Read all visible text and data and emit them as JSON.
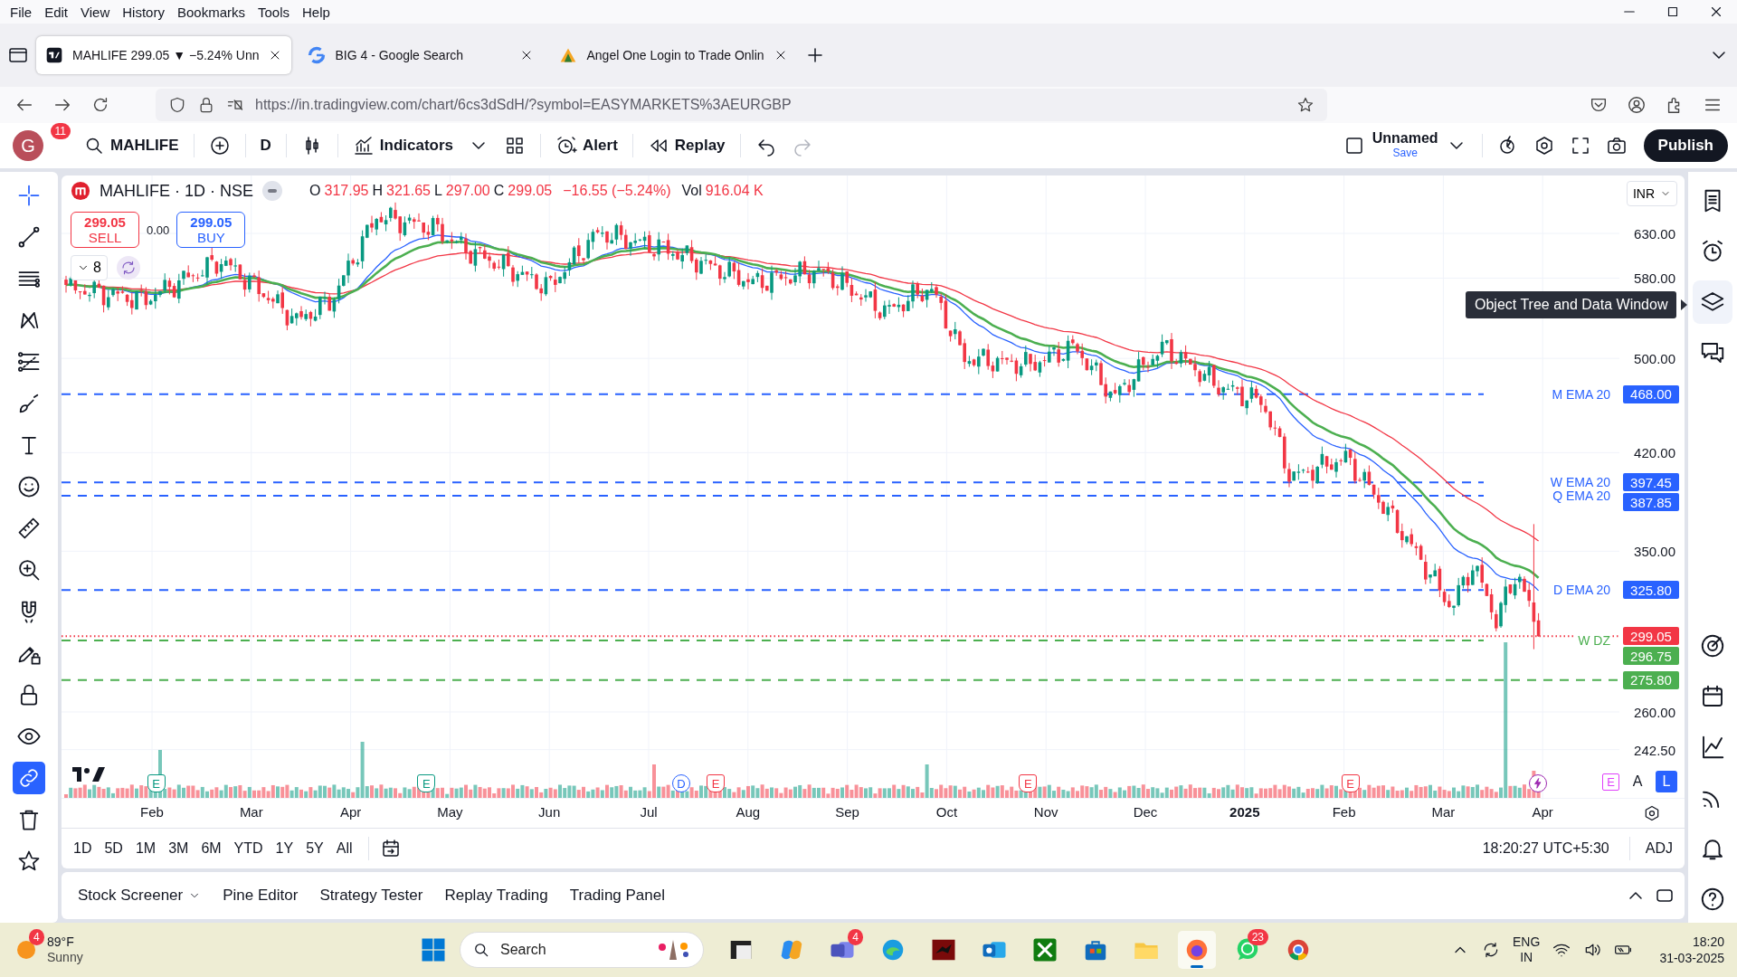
{
  "browser": {
    "menu": [
      "File",
      "Edit",
      "View",
      "History",
      "Bookmarks",
      "Tools",
      "Help"
    ],
    "tabs": [
      {
        "title": "MAHLIFE 299.05 ▼ −5.24% Unn",
        "kind": "tradingview",
        "selected": true
      },
      {
        "title": "BIG 4 - Google Search",
        "kind": "google",
        "selected": false
      },
      {
        "title": "Angel One Login to Trade Onlin",
        "kind": "angel",
        "selected": false
      }
    ],
    "url": "https://in.tradingview.com/chart/6cs3dSdH/?symbol=EASYMARKETS%3AEURGBP"
  },
  "toolbar": {
    "avatar": "G",
    "avatar_badge": "11",
    "symbol": "MAHLIFE",
    "interval": "D",
    "indicators": "Indicators",
    "alert": "Alert",
    "replay": "Replay",
    "layout_name": "Unnamed",
    "save": "Save",
    "publish": "Publish"
  },
  "left_tools": [
    {
      "kind": "crosshair",
      "selected": true,
      "on": false
    },
    {
      "kind": "trend-line",
      "selected": false,
      "on": false
    },
    {
      "kind": "lines",
      "selected": false,
      "on": false
    },
    {
      "kind": "pattern",
      "selected": false,
      "on": false
    },
    {
      "kind": "fib",
      "selected": false,
      "on": false
    },
    {
      "kind": "brush",
      "selected": false,
      "on": false
    },
    {
      "kind": "text",
      "selected": false,
      "on": false
    },
    {
      "kind": "emoji",
      "selected": false,
      "on": false
    },
    {
      "kind": "ruler",
      "selected": false,
      "on": false
    },
    {
      "kind": "zoom",
      "selected": false,
      "on": false
    },
    {
      "kind": "magnet",
      "selected": false,
      "on": false
    },
    {
      "kind": "pencil-lock",
      "selected": false,
      "on": false
    },
    {
      "kind": "lock",
      "selected": false,
      "on": false
    },
    {
      "kind": "eye",
      "selected": false,
      "on": false
    },
    {
      "kind": "link",
      "selected": false,
      "on": true
    },
    {
      "kind": "trash",
      "selected": false,
      "on": false
    },
    {
      "kind": "star",
      "selected": false,
      "on": false
    }
  ],
  "chart": {
    "title": "MAHLIFE · 1D · NSE",
    "ohlc": [
      {
        "key": "O",
        "value": "317.95"
      },
      {
        "key": "H",
        "value": "321.65"
      },
      {
        "key": "L",
        "value": "297.00"
      },
      {
        "key": "C",
        "value": "299.05"
      }
    ],
    "change": "−16.55 (−5.24%)",
    "vol_key": "Vol",
    "vol": "916.04 K",
    "sell": {
      "price": "299.05",
      "label": "SELL"
    },
    "spread": "0.00",
    "buy": {
      "price": "299.05",
      "label": "BUY"
    },
    "indicator_count": "8",
    "currency": "INR",
    "price_ticks": [
      "630.00",
      "580.00",
      "500.00",
      "420.00",
      "350.00",
      "260.00",
      "242.50"
    ],
    "levels": [
      {
        "label": "M EMA 20",
        "price": "468.00",
        "color": "#2962ff",
        "kind": "drawn"
      },
      {
        "label": "W EMA 20",
        "price": "397.45",
        "color": "#2962ff",
        "kind": "drawn"
      },
      {
        "label": "Q EMA 20",
        "price": "387.85",
        "color": "#2962ff",
        "kind": "drawn"
      },
      {
        "label": "D EMA 20",
        "price": "325.80",
        "color": "#2962ff",
        "kind": "drawn"
      },
      {
        "price": "299.05",
        "color": "#f23645",
        "kind": "last"
      },
      {
        "label": "W DZ",
        "price": "296.75",
        "color": "#4caf50",
        "kind": "drawn"
      },
      {
        "price": "275.80",
        "color": "#4caf50",
        "kind": "drawn"
      }
    ],
    "markers": [
      {
        "kind": "earnings",
        "label": "E",
        "color": "#089981"
      },
      {
        "kind": "earnings",
        "label": "E",
        "color": "#089981"
      },
      {
        "kind": "dividend",
        "label": "D",
        "color": "#2962ff"
      },
      {
        "kind": "earnings",
        "label": "E",
        "color": "#f23645"
      },
      {
        "kind": "earnings",
        "label": "E",
        "color": "#f23645"
      },
      {
        "kind": "earnings",
        "label": "E",
        "color": "#f23645"
      },
      {
        "kind": "flash",
        "color": "#9c27b0"
      }
    ],
    "time_axis": [
      {
        "text": "Feb",
        "kind": "month"
      },
      {
        "text": "Mar",
        "kind": "month"
      },
      {
        "text": "Apr",
        "kind": "month"
      },
      {
        "text": "May",
        "kind": "month"
      },
      {
        "text": "Jun",
        "kind": "month"
      },
      {
        "text": "Jul",
        "kind": "month"
      },
      {
        "text": "Aug",
        "kind": "month"
      },
      {
        "text": "Sep",
        "kind": "month"
      },
      {
        "text": "Oct",
        "kind": "month"
      },
      {
        "text": "Nov",
        "kind": "month"
      },
      {
        "text": "Dec",
        "kind": "month"
      },
      {
        "text": "2025",
        "kind": "year"
      },
      {
        "text": "Feb",
        "kind": "month"
      },
      {
        "text": "Mar",
        "kind": "month"
      },
      {
        "text": "Apr",
        "kind": "month"
      }
    ],
    "corner_events": "E",
    "scale_toggles": [
      {
        "label": "A",
        "selected": false
      },
      {
        "label": "L",
        "selected": true
      }
    ],
    "ranges": [
      "1D",
      "5D",
      "1M",
      "3M",
      "6M",
      "YTD",
      "1Y",
      "5Y",
      "All"
    ],
    "clock": "18:20:27 UTC+5:30",
    "adjust": "ADJ"
  },
  "tooltip": "Object Tree and Data Window",
  "right_sidebar": [
    {
      "kind": "watchlist",
      "selected": false
    },
    {
      "kind": "alarm",
      "selected": false
    },
    {
      "kind": "layers",
      "selected": true
    },
    {
      "kind": "chat",
      "selected": false
    },
    {
      "kind": "target",
      "selected": false
    },
    {
      "kind": "calendar",
      "selected": false
    },
    {
      "kind": "chart-line",
      "selected": false
    },
    {
      "kind": "broadcast",
      "selected": false
    },
    {
      "kind": "bell",
      "selected": false
    },
    {
      "kind": "help",
      "selected": false
    }
  ],
  "bottom_tabs": [
    {
      "label": "Stock Screener",
      "kind": "dropdown"
    },
    {
      "label": "Pine Editor",
      "kind": "plain"
    },
    {
      "label": "Strategy Tester",
      "kind": "plain"
    },
    {
      "label": "Replay Trading",
      "kind": "plain"
    },
    {
      "label": "Trading Panel",
      "kind": "plain"
    }
  ],
  "taskbar": {
    "weather": {
      "temp": "89°F",
      "condition": "Sunny",
      "badge": "4"
    },
    "search": {
      "placeholder": "Search"
    },
    "apps": [
      {
        "kind": "task-view",
        "selected": false
      },
      {
        "kind": "copilot",
        "selected": false
      },
      {
        "kind": "teams",
        "badge": "4",
        "selected": false
      },
      {
        "kind": "edge",
        "selected": false
      },
      {
        "kind": "app",
        "selected": false
      },
      {
        "kind": "outlook",
        "selected": false
      },
      {
        "kind": "xbox",
        "selected": false
      },
      {
        "kind": "store",
        "selected": false
      },
      {
        "kind": "files",
        "selected": false
      },
      {
        "kind": "firefox",
        "selected": true
      },
      {
        "kind": "whatsapp",
        "badge": "23",
        "selected": false
      },
      {
        "kind": "chrome",
        "selected": false
      }
    ],
    "language": "ENG",
    "region": "IN",
    "time": "18:20",
    "date": "31-03-2025"
  }
}
